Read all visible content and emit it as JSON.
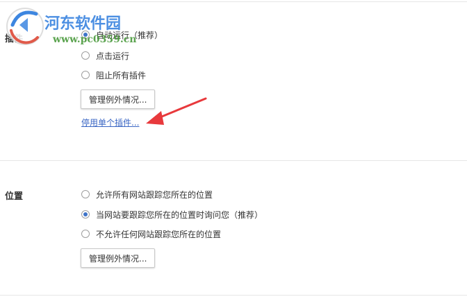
{
  "plugins": {
    "label": "插件",
    "options": [
      {
        "label": "自动运行（推荐）",
        "selected": true
      },
      {
        "label": "点击运行",
        "selected": false
      },
      {
        "label": "阻止所有插件",
        "selected": false
      }
    ],
    "manage_button": "管理例外情况...",
    "disable_link": "停用单个插件..."
  },
  "location": {
    "label": "位置",
    "options": [
      {
        "label": "允许所有网站跟踪您所在的位置",
        "selected": false
      },
      {
        "label": "当网站要跟踪您所在的位置时询问您（推荐）",
        "selected": true
      },
      {
        "label": "不允许任何网站跟踪您所在的位置",
        "selected": false
      }
    ],
    "manage_button": "管理例外情况..."
  },
  "watermark": {
    "title": "河东软件园",
    "url": "www.pc0359.cn"
  },
  "colors": {
    "arrow": "#e8393c",
    "link": "#3a66c4",
    "radio_selected": "#3f74c8",
    "watermark_title": "#3d86e0",
    "watermark_url": "#4a9a3c"
  }
}
